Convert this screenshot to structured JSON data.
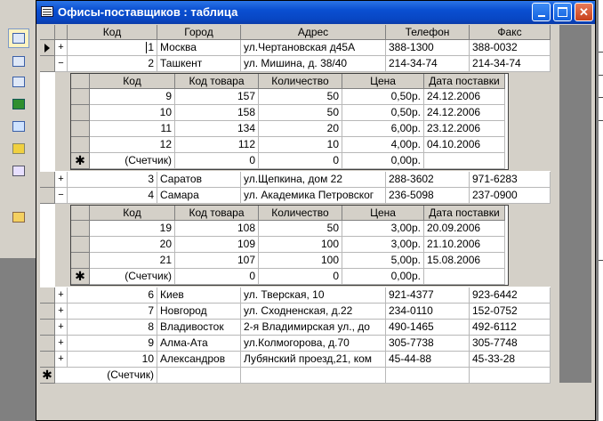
{
  "window": {
    "title": "Офисы-поставщиков : таблица"
  },
  "columns": [
    "Код",
    "Город",
    "Адрес",
    "Телефон",
    "Факс"
  ],
  "sub_columns": [
    "Код",
    "Код товара",
    "Количество",
    "Цена",
    "Дата поставки"
  ],
  "rows": [
    {
      "id": "1",
      "city": "Москва",
      "address": "ул.Чертановская д45А",
      "phone": "388-1300",
      "fax": "388-0032",
      "expander": "+"
    },
    {
      "id": "2",
      "city": "Ташкент",
      "address": "ул. Мишина, д. 38/40",
      "phone": "214-34-74",
      "fax": "214-34-74",
      "expander": "−"
    },
    {
      "id": "3",
      "city": "Саратов",
      "address": "ул.Щепкина, дом 22",
      "phone": "288-3602",
      "fax": "971-6283",
      "expander": "+"
    },
    {
      "id": "4",
      "city": "Самара",
      "address": "ул. Академика Петровског",
      "phone": "236-5098",
      "fax": "237-0900",
      "expander": "−"
    },
    {
      "id": "6",
      "city": "Киев",
      "address": "ул. Тверская, 10",
      "phone": "921-4377",
      "fax": "923-6442",
      "expander": "+"
    },
    {
      "id": "7",
      "city": "Новгород",
      "address": "ул. Сходненская, д.22",
      "phone": "234-0110",
      "fax": "152-0752",
      "expander": "+"
    },
    {
      "id": "8",
      "city": "Владивосток",
      "address": "2-я Владимирская ул., до",
      "phone": "490-1465",
      "fax": "492-6112",
      "expander": "+"
    },
    {
      "id": "9",
      "city": "Алма-Ата",
      "address": "ул.Колмогорова, д.70",
      "phone": "305-7738",
      "fax": "305-7748",
      "expander": "+"
    },
    {
      "id": "10",
      "city": "Александров",
      "address": "Лубянский проезд,21, ком",
      "phone": "45-44-88",
      "fax": "45-33-28",
      "expander": "+"
    }
  ],
  "sub_tashkent": [
    {
      "id": "9",
      "product": "157",
      "qty": "50",
      "price": "0,50р.",
      "date": "24.12.2006"
    },
    {
      "id": "10",
      "product": "158",
      "qty": "50",
      "price": "0,50р.",
      "date": "24.12.2006"
    },
    {
      "id": "11",
      "product": "134",
      "qty": "20",
      "price": "6,00р.",
      "date": "23.12.2006"
    },
    {
      "id": "12",
      "product": "112",
      "qty": "10",
      "price": "4,00р.",
      "date": "04.10.2006"
    }
  ],
  "sub_samara": [
    {
      "id": "19",
      "product": "108",
      "qty": "50",
      "price": "3,00р.",
      "date": "20.09.2006"
    },
    {
      "id": "20",
      "product": "109",
      "qty": "100",
      "price": "3,00р.",
      "date": "21.10.2006"
    },
    {
      "id": "21",
      "product": "107",
      "product_note": "",
      "qty": "100",
      "price": "5,00р.",
      "date": "15.08.2006"
    }
  ],
  "new_record": {
    "marker": "✱",
    "counter": "(Счетчик)",
    "zero": "0",
    "price": "0,00р."
  }
}
